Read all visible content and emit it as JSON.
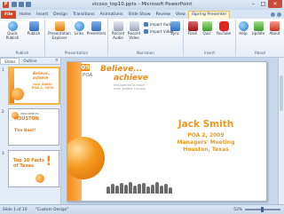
{
  "window": {
    "title": "vicoso_top10.pptx - Microsoft PowerPoint",
    "app_icon": "P"
  },
  "ribbon_tabs": [
    "File",
    "Home",
    "Insert",
    "Design",
    "Transitions",
    "Animations",
    "Slide Show",
    "Review",
    "View",
    "iSpring Presenter"
  ],
  "active_tab": "iSpring Presenter",
  "groups": {
    "publish": {
      "label": "Publish",
      "buttons": [
        "Quick Publish",
        "Publish"
      ]
    },
    "presentation": {
      "label": "Presentation",
      "buttons": [
        "Presentation Explorer",
        "Links",
        "Presenters"
      ]
    },
    "narration": {
      "label": "Narration",
      "buttons": [
        "Record Audio",
        "Record Video",
        "Sync"
      ],
      "small_buttons": [
        "Import Audio",
        "Import Video"
      ]
    },
    "insert": {
      "label": "Insert",
      "buttons": [
        "Flash",
        "Quiz",
        "YouTube"
      ]
    },
    "about": {
      "label": "About",
      "buttons": [
        "Help",
        "Update",
        "About"
      ]
    }
  },
  "panel": {
    "tabs": [
      "Slides",
      "Outline"
    ],
    "close": "×"
  },
  "thumbnails": [
    {
      "number": "1",
      "logo": "Believe... achieve",
      "name": "Jack Smith POA 2, 2009"
    },
    {
      "number": "2",
      "sub": "WELCOME TO",
      "title": "HOUSTON",
      "extra": "The Best!"
    },
    {
      "number": "3",
      "title": "Top 10 Facts of Texas",
      "excl": "!"
    }
  ],
  "slide": {
    "logo_year": "09",
    "logo_poa": "POA",
    "believe": "Believe...",
    "achieve": "achieve",
    "tagline": "empowered to reach even greater success",
    "name": "Jack Smith",
    "line1": "POA 2, 2009",
    "line2": "Managers' Meeting",
    "line3": "Houston, Texas"
  },
  "status": {
    "slide_info": "Slide 1 of 10",
    "theme": "\"Custom Design\"",
    "zoom": "53%"
  },
  "colors": {
    "accent_orange": "#f08a18",
    "file_tab": "#d24726",
    "ribbon_bg": "#e8eef7"
  }
}
